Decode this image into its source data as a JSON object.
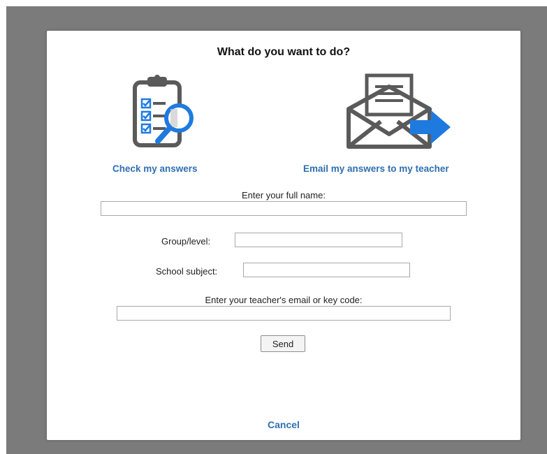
{
  "dialog": {
    "title": "What do you want to do?",
    "options": [
      {
        "label": "Check my answers",
        "icon": "clipboard-magnifier-icon"
      },
      {
        "label": "Email my answers to my teacher",
        "icon": "envelope-arrow-icon"
      }
    ],
    "form": {
      "full_name_label": "Enter your full name:",
      "full_name_value": "",
      "group_label": "Group/level:",
      "group_value": "",
      "subject_label": "School subject:",
      "subject_value": "",
      "teacher_label": "Enter your teacher's email or key code:",
      "teacher_value": ""
    },
    "send_label": "Send",
    "cancel_label": "Cancel"
  },
  "colors": {
    "accent_blue": "#2f6fb1",
    "icon_gray": "#5a5a5a",
    "icon_blue": "#1f7ae0",
    "backdrop": "#7b7b7b"
  }
}
